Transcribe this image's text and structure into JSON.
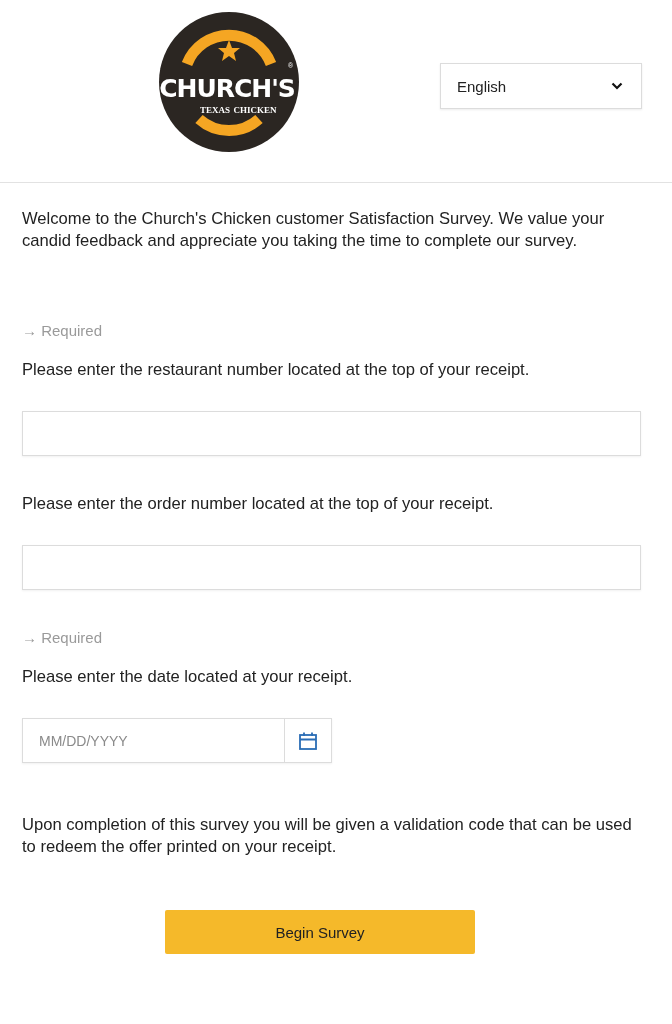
{
  "logo": {
    "name": "CHURCH'S",
    "registered": "®",
    "tagline_left": "TEXAS",
    "tagline_right": "CHICKEN"
  },
  "language": {
    "value": "English"
  },
  "intro": "Welcome to the Church's Chicken customer Satisfaction Survey. We value your candid feedback and appreciate you taking the time to complete our survey.",
  "questions": [
    {
      "required_label": "→ Required",
      "label": "Please enter the restaurant number located at the top of your receipt.",
      "kind": "text"
    },
    {
      "label": "Please enter the order number located at the top of your receipt.",
      "kind": "text"
    },
    {
      "required_label": "→ Required",
      "label": "Please enter the date located at your receipt.",
      "kind": "date",
      "placeholder": "MM/DD/YYYY"
    }
  ],
  "closing": "Upon completion of this survey you will be given a validation code that can be used to redeem the offer printed on your receipt.",
  "button": "Begin Survey"
}
